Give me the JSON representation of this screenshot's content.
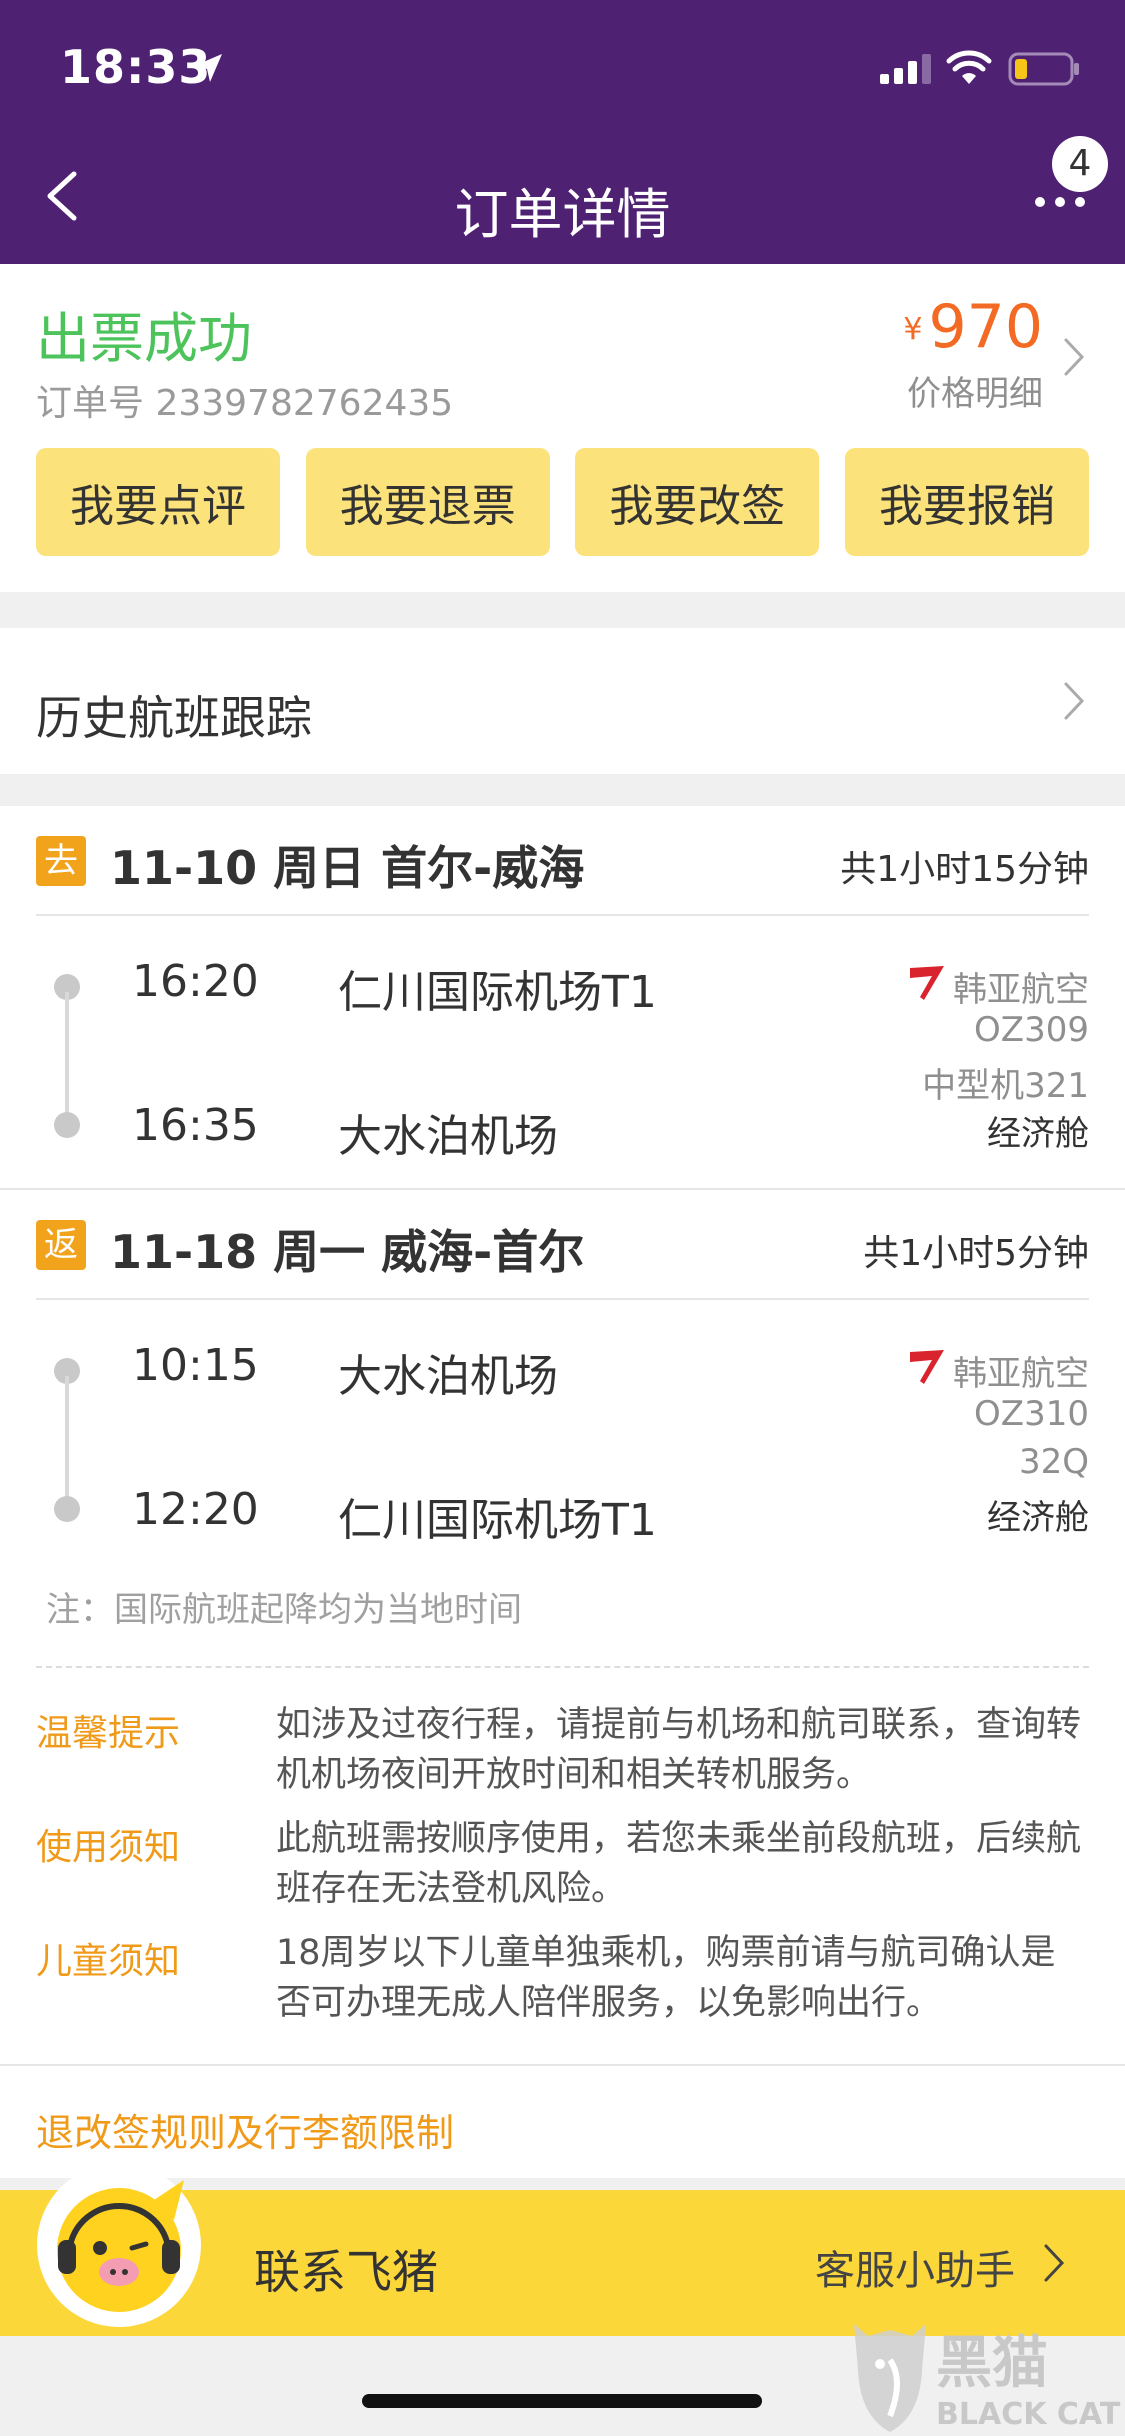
{
  "status_bar": {
    "time": "18:33"
  },
  "nav": {
    "title": "订单详情",
    "badge": "4"
  },
  "order": {
    "status": "出票成功",
    "order_number": "订单号 2339782762435",
    "currency": "¥",
    "price": "970",
    "price_detail": "价格明细"
  },
  "actions": [
    "我要点评",
    "我要退票",
    "我要改签",
    "我要报销"
  ],
  "history": {
    "label": "历史航班跟踪"
  },
  "flights": [
    {
      "tag": "去",
      "route": "11-10 周日 首尔-威海",
      "duration": "共1小时15分钟",
      "depart_time": "16:20",
      "depart_airport": "仁川国际机场T1",
      "arrive_time": "16:35",
      "arrive_airport": "大水泊机场",
      "airline": "韩亚航空",
      "flight_no": "OZ309",
      "aircraft": "中型机321",
      "cabin": "经济舱"
    },
    {
      "tag": "返",
      "route": "11-18 周一 威海-首尔",
      "duration": "共1小时5分钟",
      "depart_time": "10:15",
      "depart_airport": "大水泊机场",
      "arrive_time": "12:20",
      "arrive_airport": "仁川国际机场T1",
      "airline": "韩亚航空",
      "flight_no": "OZ310",
      "aircraft": "32Q",
      "cabin": "经济舱"
    }
  ],
  "note": "注：国际航班起降均为当地时间",
  "tips": [
    {
      "label": "温馨提示",
      "text": "如涉及过夜行程，请提前与机场和航司联系，查询转机机场夜间开放时间和相关转机服务。"
    },
    {
      "label": "使用须知",
      "text": "此航班需按顺序使用，若您未乘坐前段航班，后续航班存在无法登机风险。"
    },
    {
      "label": "儿童须知",
      "text": "18周岁以下儿童单独乘机，购票前请与航司确认是否可办理无成人陪伴服务，以免影响出行。"
    }
  ],
  "rules_link": "退改签规则及行李额限制",
  "contact": {
    "label": "联系飞猪",
    "assistant": "客服小助手"
  },
  "watermark": {
    "text_cn": "黑猫",
    "text_en": "BLACK CAT"
  },
  "colors": {
    "header": "#4f2173",
    "success": "#4cc35b",
    "price": "#f26a23",
    "button": "#fce27a",
    "accent": "#f09a1a",
    "contact_bar": "#fcd73a"
  }
}
